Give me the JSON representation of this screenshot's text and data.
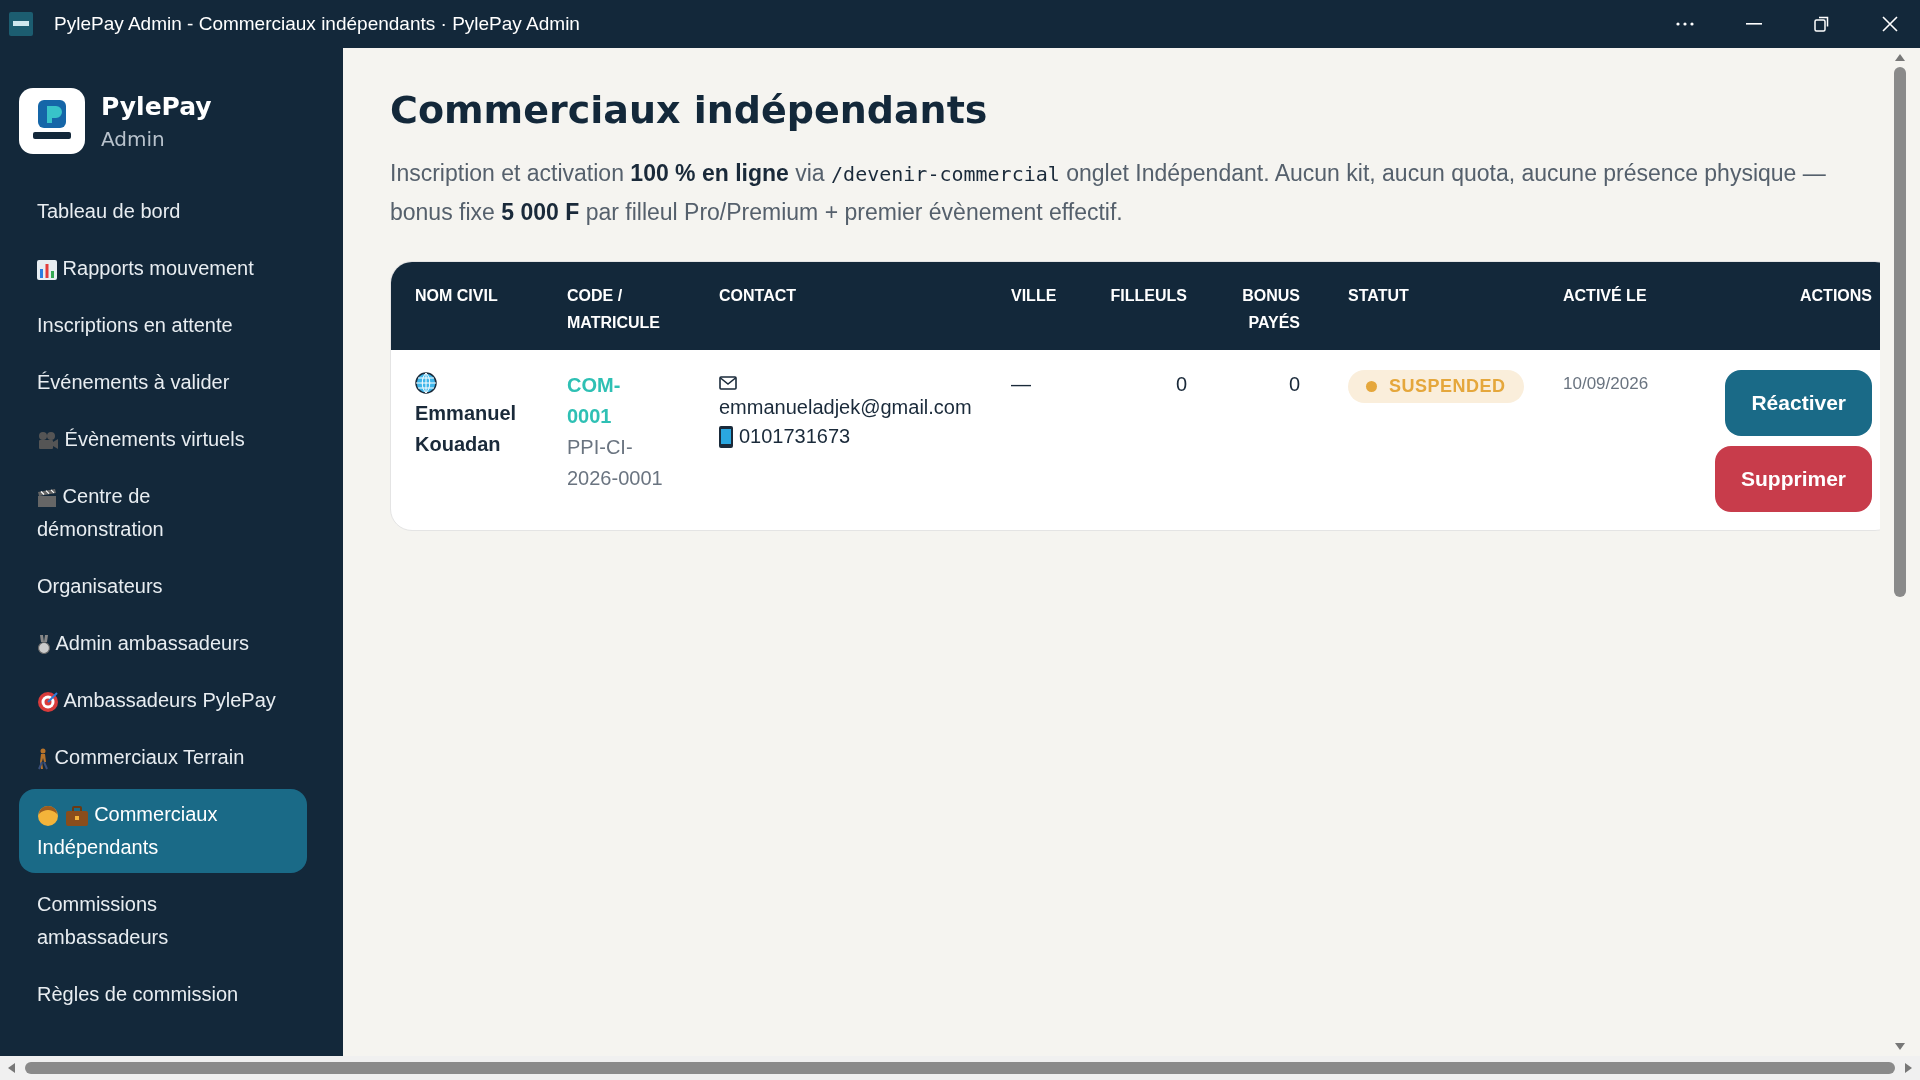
{
  "window": {
    "title": "PylePay Admin - Commerciaux indépendants · PylePay Admin"
  },
  "brand": {
    "name": "PylePay",
    "subtitle": "Admin"
  },
  "sidebar": {
    "items": [
      {
        "label": "Tableau de bord",
        "selected": false
      },
      {
        "label": "Rapports mouvement",
        "selected": false
      },
      {
        "label": "Inscriptions en attente",
        "selected": false
      },
      {
        "label": "Événements à valider",
        "selected": false
      },
      {
        "label": "Évènements virtuels",
        "selected": false
      },
      {
        "label": "Centre de démonstration",
        "selected": false
      },
      {
        "label": "Organisateurs",
        "selected": false
      },
      {
        "label": "Admin ambassadeurs",
        "selected": false
      },
      {
        "label": "Ambassadeurs PylePay",
        "selected": false
      },
      {
        "label": "Commerciaux Terrain",
        "selected": false
      },
      {
        "label": "Commerciaux Indépendants",
        "selected": true
      },
      {
        "label": "Commissions ambassadeurs",
        "selected": false
      },
      {
        "label": "Règles de commission",
        "selected": false
      }
    ]
  },
  "page": {
    "title": "Commerciaux indépendants",
    "intro": {
      "text_before": "Inscription et activation **100 % en ligne** via",
      "command": "/devenir-commercial",
      "text_after": "onglet Indépendant. Aucun kit, aucun quota, aucune présence physique — bonus fixe **5 000 F** par filleul Pro/Premium + premier évènement effectif."
    }
  },
  "table": {
    "columns": [
      "NOM CIVIL",
      "CODE / MATRICULE",
      "CONTACT",
      "VILLE",
      "FILLEULS",
      "BONUS PAYÉS",
      "STATUT",
      "ACTIVÉ LE",
      "ACTIONS"
    ],
    "rows": [
      {
        "name": "Emmanuel Kouadan",
        "code": "COM-0001",
        "matricule": "PPI-CI-2026-0001",
        "email": "emmanueladjek@gmail.com",
        "phone": "0101731673",
        "city": "—",
        "referrals": "0",
        "bonus_paid": "0",
        "status": {
          "label": "SUSPENDED",
          "kind": "suspended"
        },
        "activated": "10/09/2026",
        "actions": [
          {
            "label": "Réactiver",
            "kind": "primary"
          },
          {
            "label": "Supprimer",
            "kind": "danger"
          }
        ]
      }
    ]
  }
}
